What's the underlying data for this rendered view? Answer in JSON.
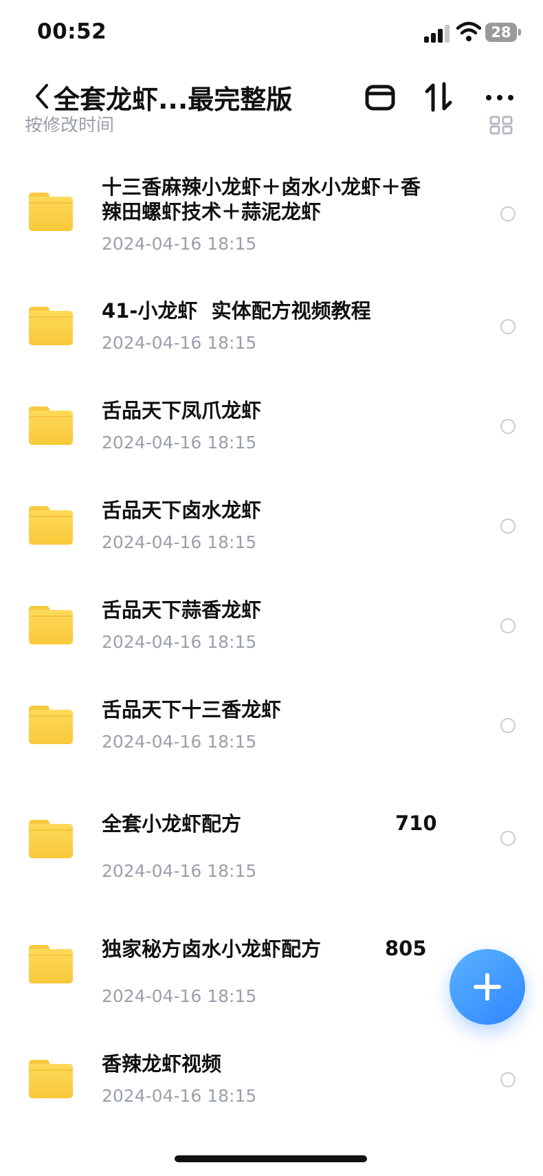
{
  "status_bar": {
    "time": "00:52",
    "battery": "28"
  },
  "header": {
    "title": "全套龙虾...最完整版"
  },
  "sort_hint": "按修改时间",
  "files": [
    {
      "name": "十三香麻辣小龙虾＋卤水小龙虾＋香辣田螺虾技术＋蒜泥龙虾",
      "date": "2024-04-16 18:15",
      "count": ""
    },
    {
      "name": "41-小龙虾  实体配方视频教程",
      "date": "2024-04-16 18:15",
      "count": ""
    },
    {
      "name": "舌品天下凤爪龙虾",
      "date": "2024-04-16 18:15",
      "count": ""
    },
    {
      "name": "舌品天下卤水龙虾",
      "date": "2024-04-16 18:15",
      "count": ""
    },
    {
      "name": "舌品天下蒜香龙虾",
      "date": "2024-04-16 18:15",
      "count": ""
    },
    {
      "name": "舌品天下十三香龙虾",
      "date": "2024-04-16 18:15",
      "count": ""
    },
    {
      "name": "全套小龙虾配方",
      "date": "2024-04-16 18:15",
      "count": "710"
    },
    {
      "name": "独家秘方卤水小龙虾配方",
      "date": "2024-04-16 18:15",
      "count": "805"
    },
    {
      "name": "香辣龙虾视频",
      "date": "2024-04-16 18:15",
      "count": ""
    }
  ],
  "colors": {
    "accent": "#2f86ff",
    "folder": "#f8c93a",
    "secondary_text": "#9aa0ab"
  },
  "icons": {
    "back": "chevron-left-icon",
    "archive": "archive-icon",
    "sort": "sort-icon",
    "more": "more-icon",
    "grid": "grid-icon",
    "folder": "folder-icon",
    "add": "plus-icon"
  }
}
